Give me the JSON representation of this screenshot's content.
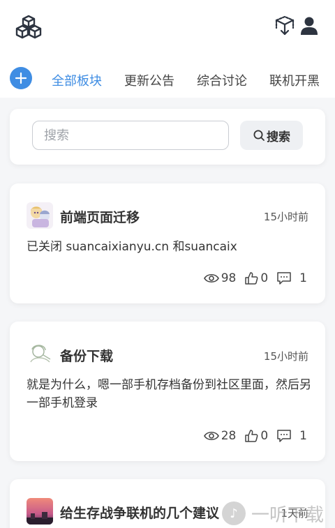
{
  "header": {
    "logo_icon": "cubes-logo-icon",
    "actions": [
      "cube-download-icon",
      "user-icon"
    ]
  },
  "tabs": [
    {
      "label": "全部板块",
      "active": true
    },
    {
      "label": "更新公告",
      "active": false
    },
    {
      "label": "综合讨论",
      "active": false
    },
    {
      "label": "联机开黑",
      "active": false
    }
  ],
  "search": {
    "placeholder": "搜索",
    "button_label": "搜索"
  },
  "posts": [
    {
      "title": "前端页面迁移",
      "time": "15小时前",
      "body": "已关闭 suancaixianyu.cn 和suancaix",
      "views": "98",
      "likes": "0",
      "comments": "1"
    },
    {
      "title": "备份下载",
      "time": "15小时前",
      "body": "就是为什么，嗯一部手机存档备份到社区里面，然后另一部手机登录",
      "views": "28",
      "likes": "0",
      "comments": "1"
    },
    {
      "title": "给生存战争联机的几个建议",
      "time": "1天前"
    }
  ],
  "watermark": {
    "text": "一听下载"
  },
  "colors": {
    "accent": "#3f8de3",
    "background": "#f5f6f8",
    "card": "#ffffff"
  }
}
